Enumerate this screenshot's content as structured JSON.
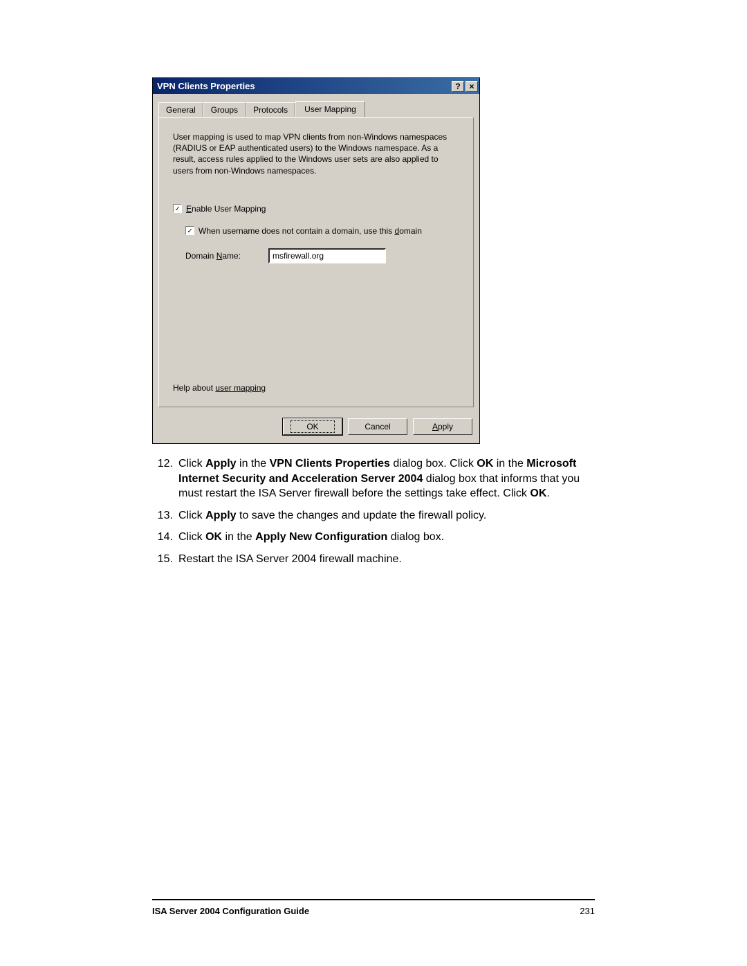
{
  "dialog": {
    "title": "VPN Clients Properties",
    "help_button_glyph": "?",
    "close_button_glyph": "×",
    "tabs": [
      {
        "label": "General"
      },
      {
        "label": "Groups"
      },
      {
        "label": "Protocols"
      },
      {
        "label": "User Mapping"
      }
    ],
    "active_tab_index": 3,
    "description": "User mapping is used to map VPN clients from non-Windows namespaces (RADIUS or EAP authenticated users) to the Windows namespace. As a result, access rules applied to the Windows user sets are also applied to users from non-Windows namespaces.",
    "enable_checkbox": {
      "checked": true,
      "label_pre": "",
      "label_underline": "E",
      "label_post": "nable User Mapping"
    },
    "when_checkbox": {
      "checked": true,
      "label_pre": "When username does not contain a domain, use this ",
      "label_underline": "d",
      "label_post": "omain"
    },
    "domain_label_pre": "Domain ",
    "domain_label_underline": "N",
    "domain_label_post": "ame:",
    "domain_value": "msfirewall.org",
    "help_prefix": "Help about ",
    "help_link": "user mapping",
    "buttons": {
      "ok": "OK",
      "cancel": "Cancel",
      "apply_pre": "",
      "apply_underline": "A",
      "apply_post": "pply"
    }
  },
  "instructions": [
    {
      "num": "12.",
      "parts": [
        {
          "t": "Click "
        },
        {
          "t": "Apply",
          "b": true
        },
        {
          "t": " in the "
        },
        {
          "t": "VPN Clients Properties",
          "b": true
        },
        {
          "t": " dialog box. Click "
        },
        {
          "t": "OK",
          "b": true
        },
        {
          "t": " in the "
        },
        {
          "t": "Microsoft Internet Security and Acceleration Server 2004",
          "b": true
        },
        {
          "t": " dialog box that informs that you must restart the ISA Server firewall before the settings take effect. Click "
        },
        {
          "t": "OK",
          "b": true
        },
        {
          "t": "."
        }
      ]
    },
    {
      "num": "13.",
      "parts": [
        {
          "t": "Click "
        },
        {
          "t": "Apply",
          "b": true
        },
        {
          "t": " to save the changes and update the firewall policy."
        }
      ]
    },
    {
      "num": "14.",
      "parts": [
        {
          "t": "Click "
        },
        {
          "t": "OK",
          "b": true
        },
        {
          "t": " in the "
        },
        {
          "t": "Apply New Configuration",
          "b": true
        },
        {
          "t": " dialog box."
        }
      ]
    },
    {
      "num": "15.",
      "parts": [
        {
          "t": "Restart the ISA Server 2004 firewall machine."
        }
      ]
    }
  ],
  "footer": {
    "title": "ISA Server 2004 Configuration Guide",
    "page": "231"
  }
}
